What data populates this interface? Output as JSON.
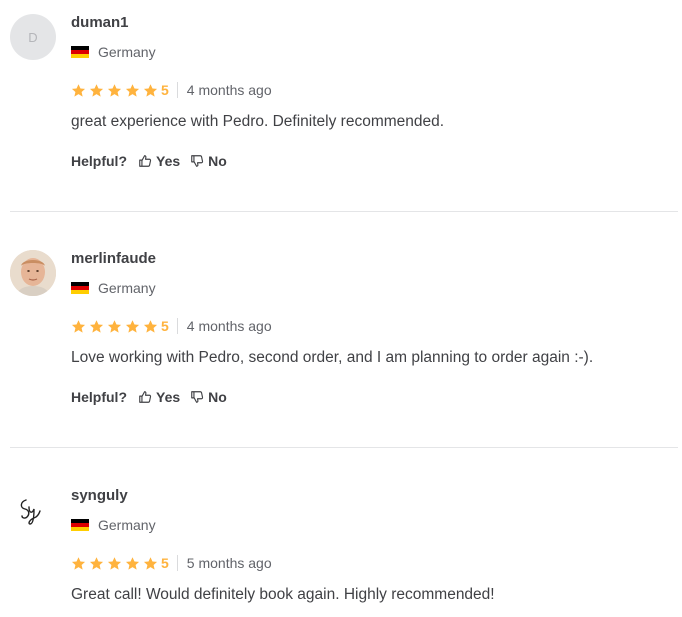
{
  "reviews": [
    {
      "username": "duman1",
      "avatar_type": "initial",
      "avatar_initial": "D",
      "country": "Germany",
      "flag_colors": [
        "#000000",
        "#dd0000",
        "#ffce00"
      ],
      "rating": 5,
      "rating_text": "5",
      "time_ago": "4 months ago",
      "comment": "great experience with Pedro. Definitely recommended.",
      "helpful_label": "Helpful?",
      "yes_label": "Yes",
      "no_label": "No"
    },
    {
      "username": "merlinfaude",
      "avatar_type": "photo",
      "country": "Germany",
      "flag_colors": [
        "#000000",
        "#dd0000",
        "#ffce00"
      ],
      "rating": 5,
      "rating_text": "5",
      "time_ago": "4 months ago",
      "comment": "Love working with Pedro, second order, and I am planning to order again :-).",
      "helpful_label": "Helpful?",
      "yes_label": "Yes",
      "no_label": "No"
    },
    {
      "username": "synguly",
      "avatar_type": "signature-logo",
      "country": "Germany",
      "flag_colors": [
        "#000000",
        "#dd0000",
        "#ffce00"
      ],
      "rating": 5,
      "rating_text": "5",
      "time_ago": "5 months ago",
      "comment": "Great call! Would definitely book again. Highly recommended!"
    }
  ],
  "colors": {
    "star": "#ffb33e",
    "text": "#404145",
    "muted": "#62646a",
    "divider": "#e4e5e7"
  }
}
